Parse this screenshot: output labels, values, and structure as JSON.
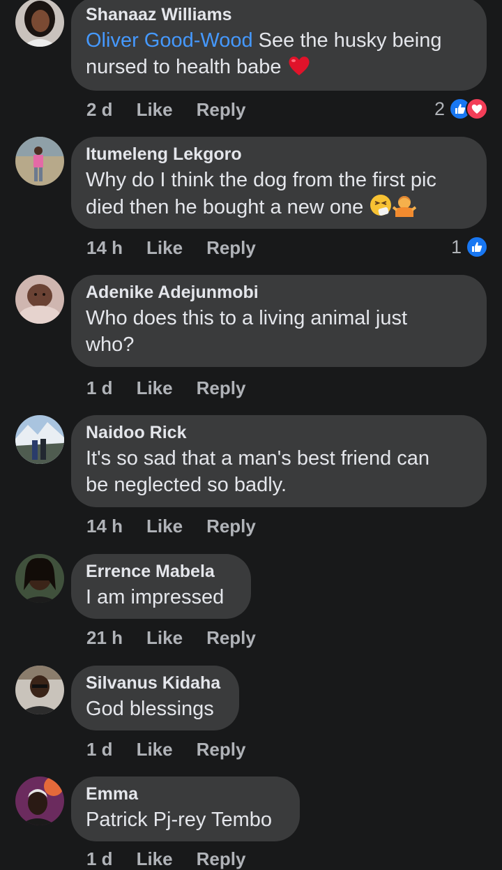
{
  "comments": [
    {
      "author": "Shanaaz Williams",
      "mention": "Oliver Good-Wood",
      "text_line1": " See the husky being",
      "text_line2": "nursed to health babe",
      "time": "2 d",
      "like": "Like",
      "reply": "Reply",
      "reaction_count": "2",
      "reactions": [
        "like-icon",
        "love-icon"
      ],
      "inline_emoji": [
        "red-heart-emoji"
      ]
    },
    {
      "author": "Itumeleng  Lekgoro",
      "text_line1": "Why do I think the dog from the first pic",
      "text_line2": "died then he bought a new one",
      "time": "14 h",
      "like": "Like",
      "reply": "Reply",
      "reaction_count": "1",
      "reactions": [
        "like-icon"
      ],
      "inline_emoji": [
        "sneezing-face-emoji",
        "shrugging-person-emoji"
      ]
    },
    {
      "author": "Adenike Adejunmobi",
      "text_line1": "Who does this to a living animal just",
      "text_line2": "who?",
      "time": "1 d",
      "like": "Like",
      "reply": "Reply"
    },
    {
      "author": "Naidoo Rick",
      "text_line1": "It's so sad that a man's best friend can",
      "text_line2": "be neglected so badly.",
      "time": "14 h",
      "like": "Like",
      "reply": "Reply"
    },
    {
      "author": "Errence Mabela",
      "text_line1": "I am impressed",
      "time": "21 h",
      "like": "Like",
      "reply": "Reply"
    },
    {
      "author": "Silvanus Kidaha",
      "text_line1": "God blessings",
      "time": "1 d",
      "like": "Like",
      "reply": "Reply"
    },
    {
      "author": "Emma",
      "text_line1": "Patrick Pj-rey Tembo",
      "time": "1 d",
      "like": "Like",
      "reply": "Reply"
    }
  ],
  "colors": {
    "background": "#18191a",
    "bubble": "#3a3b3c",
    "text": "#e4e6eb",
    "meta": "#b0b3b8",
    "mention": "#4599ff",
    "like_blue": "#1877f2",
    "love_red": "#f33e58"
  }
}
